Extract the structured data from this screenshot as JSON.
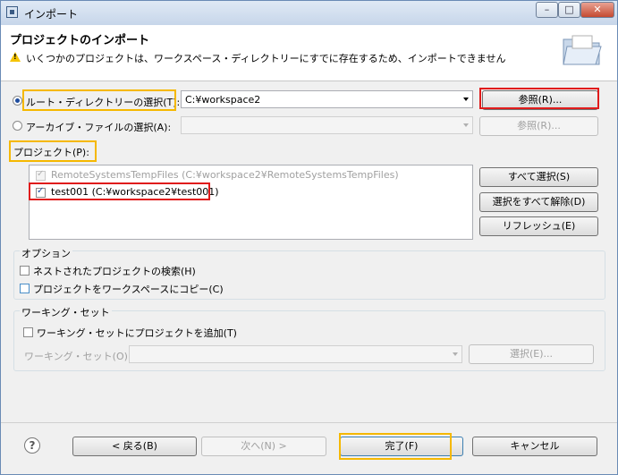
{
  "window": {
    "title": "インポート",
    "controls": [
      "minimize",
      "maximize",
      "close"
    ]
  },
  "header": {
    "title": "プロジェクトのインポート",
    "warning": "いくつかのプロジェクトは、ワークスペース・ディレクトリーにすでに存在するため、インポートできません",
    "icons": [
      "warning-icon",
      "folder-icon"
    ]
  },
  "source": {
    "root_dir_label": "ルート・ディレクトリーの選択(T):",
    "root_dir_value": "C:¥workspace2",
    "root_browse_label": "参照(R)...",
    "archive_label": "アーカイブ・ファイルの選択(A):",
    "archive_value": "",
    "archive_browse_label": "参照(R)..."
  },
  "projects": {
    "label": "プロジェクト(P):",
    "items": [
      {
        "label": "RemoteSystemsTempFiles (C:¥workspace2¥RemoteSystemsTempFiles)",
        "checked": true,
        "enabled": false
      },
      {
        "label": "test001 (C:¥workspace2¥test001)",
        "checked": true,
        "enabled": true
      }
    ],
    "select_all_label": "すべて選択(S)",
    "deselect_all_label": "選択をすべて解除(D)",
    "refresh_label": "リフレッシュ(E)"
  },
  "options": {
    "title": "オプション",
    "search_nested_label": "ネストされたプロジェクトの検索(H)",
    "search_nested_checked": false,
    "copy_projects_label": "プロジェクトをワークスペースにコピー(C)",
    "copy_projects_checked": false
  },
  "working_sets": {
    "title": "ワーキング・セット",
    "add_label": "ワーキング・セットにプロジェクトを追加(T)",
    "add_checked": false,
    "field_label": "ワーキング・セット(O):",
    "field_value": "",
    "select_label": "選択(E)..."
  },
  "footer": {
    "back_label": "< 戻る(B)",
    "next_label": "次へ(N) >",
    "finish_label": "完了(F)",
    "cancel_label": "キャンセル"
  },
  "colors": {
    "annotation_red": "#e01b1b",
    "annotation_orange": "#f5b800",
    "title_bar": "#c7d6ea"
  }
}
